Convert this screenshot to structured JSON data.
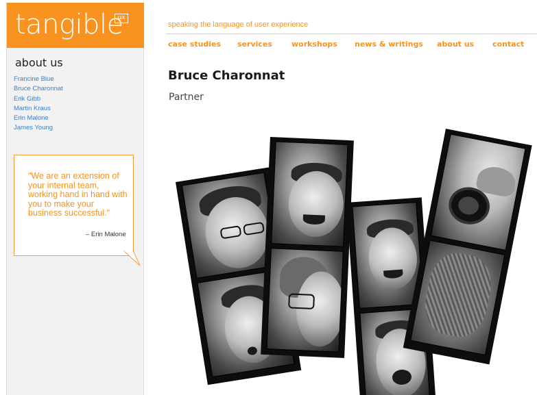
{
  "logo": {
    "text": "tangible",
    "badge": "ux"
  },
  "sidebar": {
    "title": "about us",
    "people": [
      "Francine Blue",
      "Bruce Charonnat",
      "Erik Gibb",
      "Martin Kraus",
      "Erin Malone",
      "James Young"
    ]
  },
  "quote": {
    "text": "\"We are an extension of your internal team, working hand in hand with you to make your business successful.\"",
    "author": "– Erin Malone"
  },
  "header": {
    "tagline": "speaking the language of user experience",
    "nav": [
      "case studies",
      "services",
      "workshops",
      "news & writings",
      "about us",
      "contact"
    ]
  },
  "profile": {
    "name": "Bruce Charonnat",
    "role": "Partner"
  },
  "colors": {
    "brand": "#f7931e",
    "link": "#3a7fc4",
    "strip": "#0d0d0d"
  }
}
